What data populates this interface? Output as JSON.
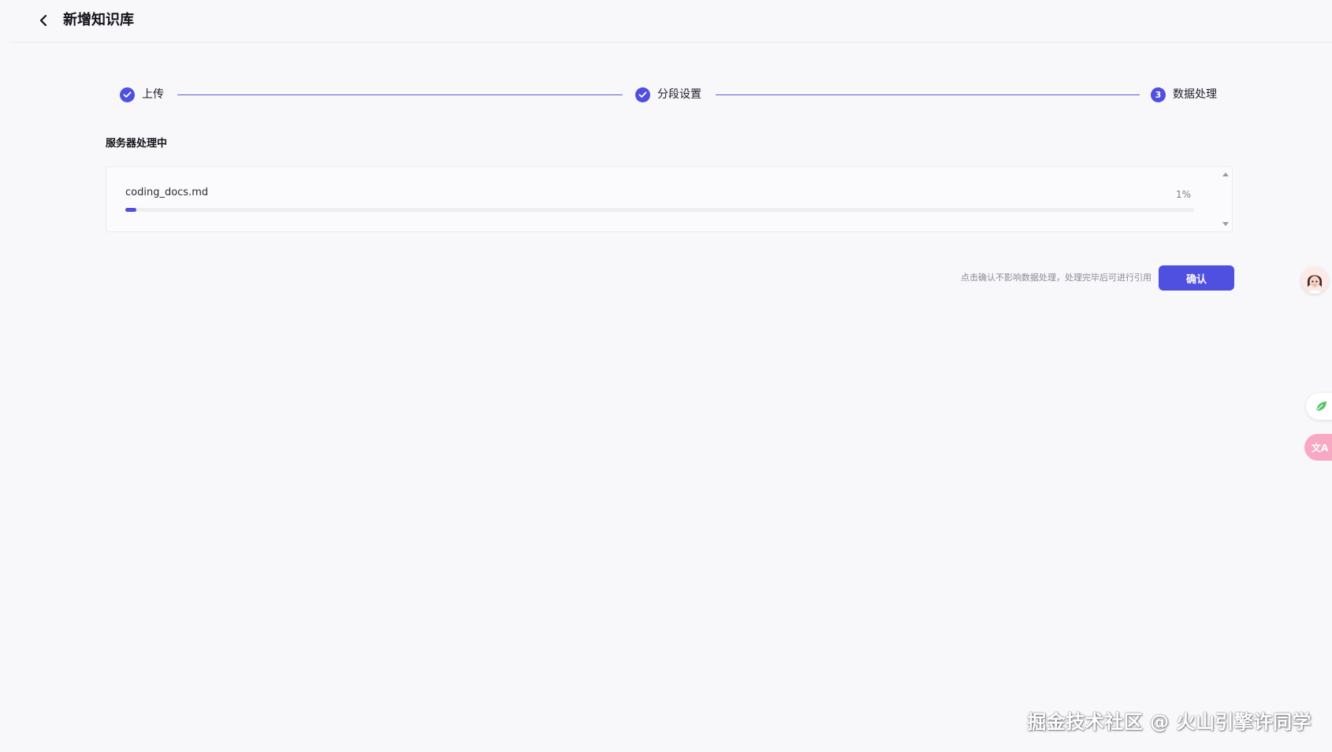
{
  "header": {
    "title": "新增知识库"
  },
  "steps": [
    {
      "label": "上传",
      "status": "done",
      "marker": ""
    },
    {
      "label": "分段设置",
      "status": "done",
      "marker": ""
    },
    {
      "label": "数据处理",
      "status": "current",
      "marker": "3"
    }
  ],
  "main": {
    "section_title": "服务器处理中",
    "files": [
      {
        "name": "coding_docs.md",
        "percent_label": "1%",
        "progress": 0.01
      }
    ],
    "hint": "点击确认不影响数据处理，处理完毕后可进行引用",
    "confirm_label": "确认"
  },
  "floating": {
    "translate_glyph": "文A"
  },
  "watermark": "掘金技术社区 @ 火山引擎许同学",
  "colors": {
    "accent": "#4f4fe0",
    "background": "#f8f8fb"
  }
}
